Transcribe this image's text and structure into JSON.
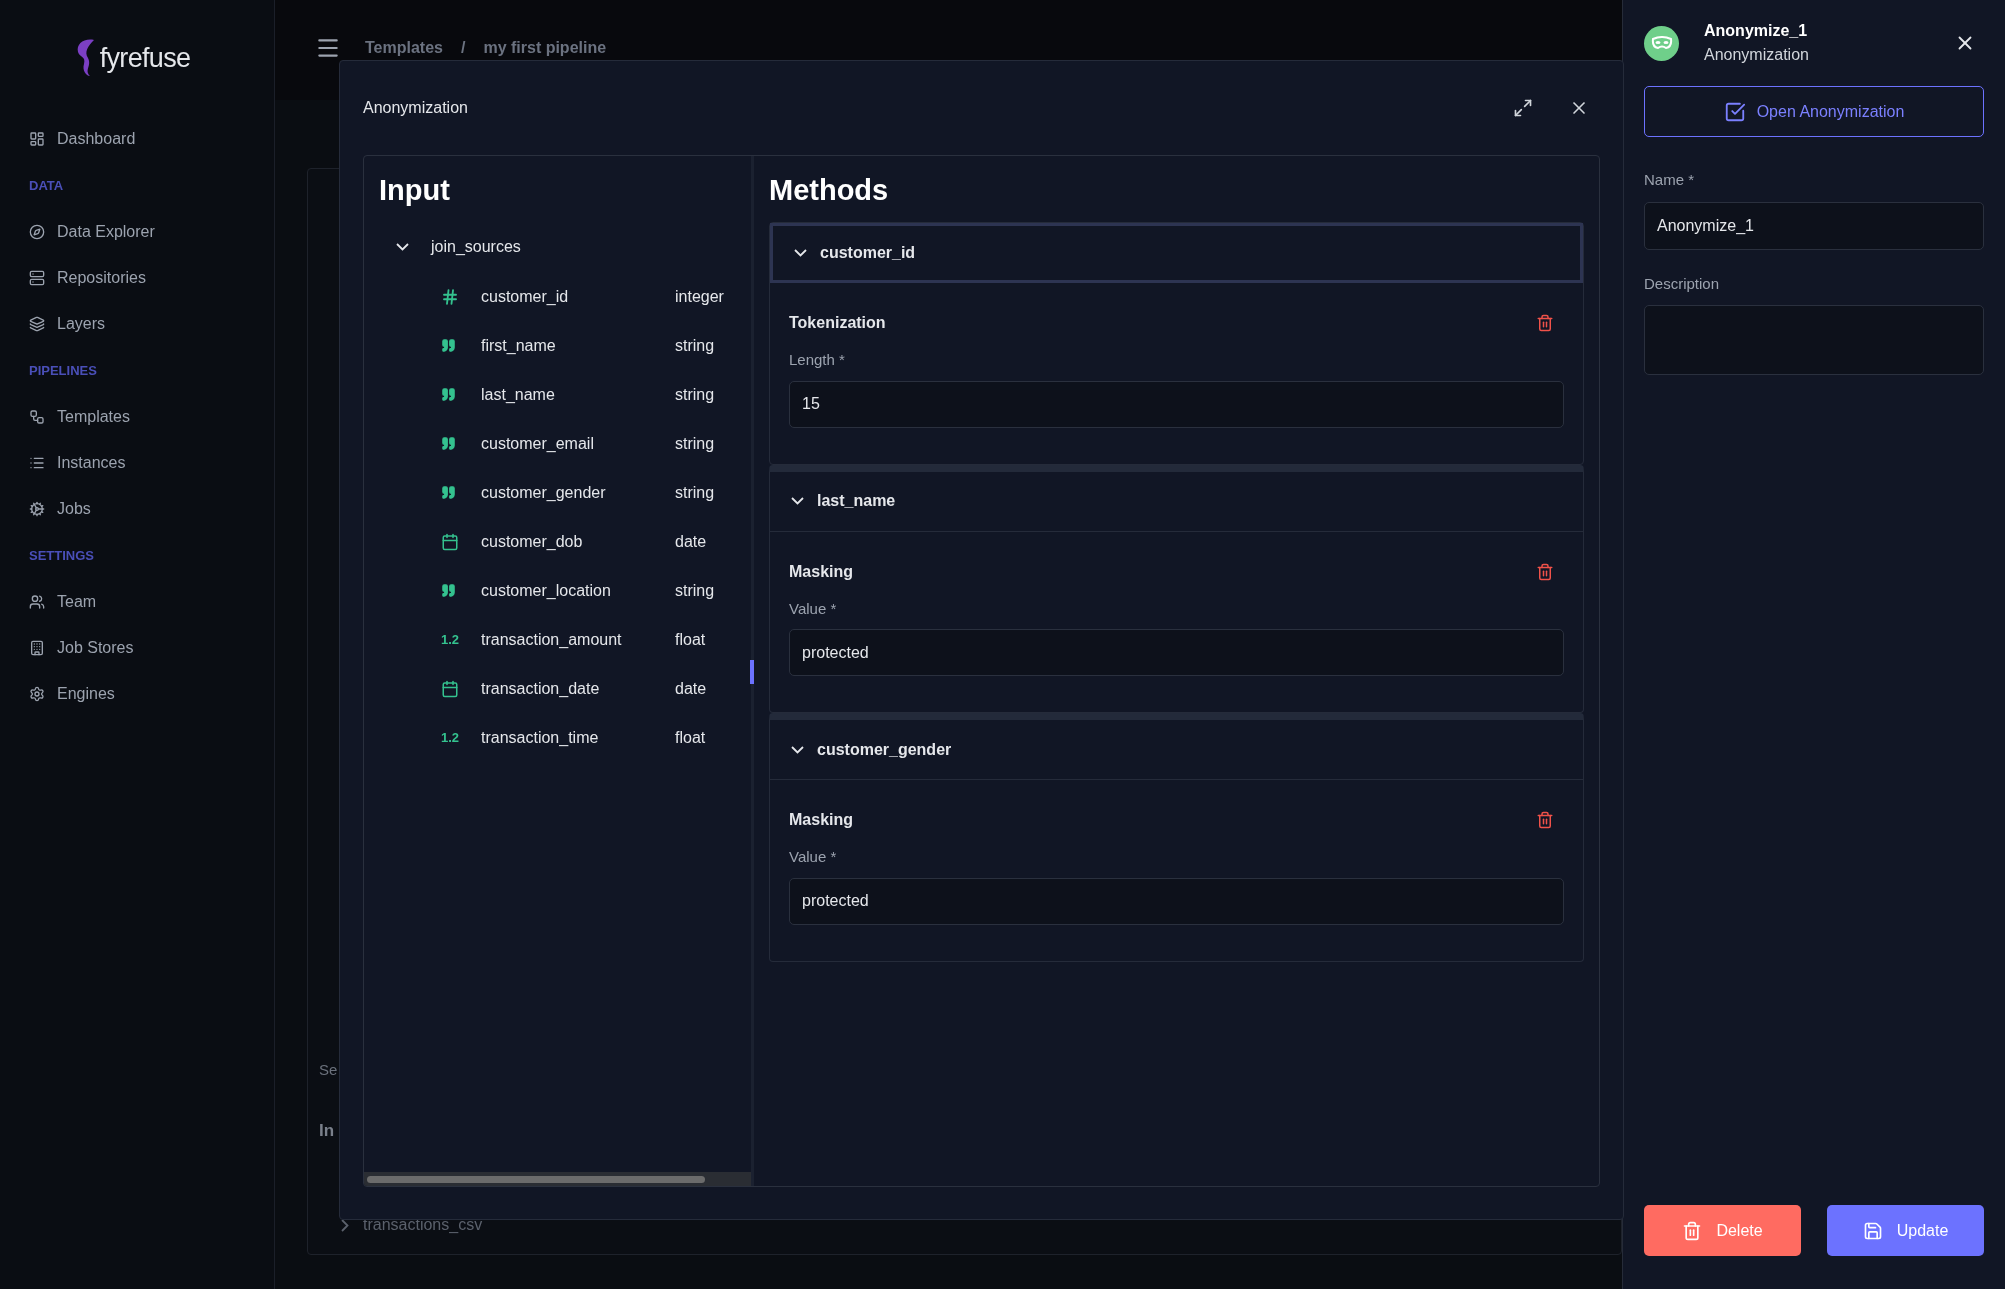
{
  "sidebar": {
    "logo": "fyrefuse",
    "sections": [
      {
        "items": [
          "Dashboard"
        ]
      },
      {
        "heading": "DATA",
        "items": [
          "Data Explorer",
          "Repositories",
          "Layers"
        ]
      },
      {
        "heading": "PIPELINES",
        "items": [
          "Templates",
          "Instances",
          "Jobs"
        ]
      },
      {
        "heading": "SETTINGS",
        "items": [
          "Team",
          "Job Stores",
          "Engines"
        ]
      }
    ]
  },
  "breadcrumb": [
    "Templates",
    "my first pipeline"
  ],
  "breadcrumb_separator": "/",
  "background_page": {
    "label_1": "Se",
    "label_2": "In",
    "tree_item": "transactions_csv"
  },
  "modal": {
    "title": "Anonymization",
    "input": {
      "heading": "Input",
      "source": {
        "name": "join_sources",
        "expanded": true,
        "columns": [
          {
            "kind": "hash",
            "name": "customer_id",
            "type": "integer"
          },
          {
            "kind": "quote",
            "name": "first_name",
            "type": "string"
          },
          {
            "kind": "quote",
            "name": "last_name",
            "type": "string"
          },
          {
            "kind": "quote",
            "name": "customer_email",
            "type": "string"
          },
          {
            "kind": "quote",
            "name": "customer_gender",
            "type": "string"
          },
          {
            "kind": "calendar",
            "name": "customer_dob",
            "type": "date"
          },
          {
            "kind": "quote",
            "name": "customer_location",
            "type": "string"
          },
          {
            "kind": "decimal",
            "glyph": "1.2",
            "name": "transaction_amount",
            "type": "float"
          },
          {
            "kind": "calendar",
            "name": "transaction_date",
            "type": "date"
          },
          {
            "kind": "decimal",
            "glyph": "1.2",
            "name": "transaction_time",
            "type": "float"
          }
        ]
      }
    },
    "methods": {
      "heading": "Methods",
      "items": [
        {
          "column": "customer_id",
          "expanded": true,
          "focused": true,
          "method": "Tokenization",
          "field_label": "Length *",
          "value": "15"
        },
        {
          "column": "last_name",
          "expanded": true,
          "focused": false,
          "method": "Masking",
          "field_label": "Value *",
          "value": "protected"
        },
        {
          "column": "customer_gender",
          "expanded": true,
          "focused": false,
          "method": "Masking",
          "field_label": "Value *",
          "value": "protected"
        }
      ]
    }
  },
  "panel": {
    "title": "Anonymize_1",
    "subtitle": "Anonymization",
    "open_button": "Open Anonymization",
    "name_label": "Name *",
    "name_value": "Anonymize_1",
    "description_label": "Description",
    "buttons": [
      {
        "kind": "danger",
        "label": "Delete"
      },
      {
        "kind": "primary",
        "label": "Update"
      }
    ]
  }
}
